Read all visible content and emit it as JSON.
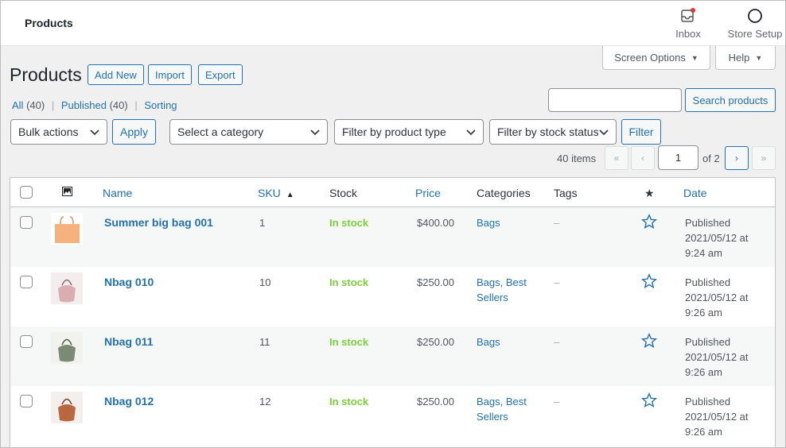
{
  "header": {
    "title": "Products",
    "inbox_label": "Inbox",
    "store_setup_label": "Store Setup"
  },
  "screen_options_label": "Screen Options",
  "help_label": "Help",
  "page": {
    "title": "Products",
    "add_new": "Add New",
    "import": "Import",
    "export": "Export"
  },
  "views": {
    "all": "All",
    "all_count": "(40)",
    "published": "Published",
    "published_count": "(40)",
    "sorting": "Sorting",
    "separator": "|"
  },
  "search": {
    "value": "",
    "button": "Search products"
  },
  "filters": {
    "bulk_actions": "Bulk actions",
    "apply": "Apply",
    "category": "Select a category",
    "product_type": "Filter by product type",
    "stock_status": "Filter by stock status",
    "filter": "Filter"
  },
  "pagination": {
    "items": "40 items",
    "first": "«",
    "prev": "‹",
    "current": "1",
    "of": "of 2",
    "next": "›",
    "last": "»"
  },
  "table": {
    "columns": {
      "name": "Name",
      "sku": "SKU",
      "sku_sort_indicator": "▲",
      "stock": "Stock",
      "price": "Price",
      "categories": "Categories",
      "tags": "Tags",
      "featured": "★",
      "date": "Date"
    },
    "rows": [
      {
        "name": "Summer big bag 001",
        "sku": "1",
        "stock": "In stock",
        "price": "$400.00",
        "categories": "Bags",
        "tags": "–",
        "date_status": "Published",
        "date": "2021/05/12 at",
        "time": "9:24 am",
        "thumb_color": "#f6b27d"
      },
      {
        "name": "Nbag 010",
        "sku": "10",
        "stock": "In stock",
        "price": "$250.00",
        "categories": "Bags, Best Sellers",
        "tags": "–",
        "date_status": "Published",
        "date": "2021/05/12 at",
        "time": "9:26 am",
        "thumb_color": "#d9aeb3"
      },
      {
        "name": "Nbag 011",
        "sku": "11",
        "stock": "In stock",
        "price": "$250.00",
        "categories": "Bags",
        "tags": "–",
        "date_status": "Published",
        "date": "2021/05/12 at",
        "time": "9:26 am",
        "thumb_color": "#7b8a72"
      },
      {
        "name": "Nbag 012",
        "sku": "12",
        "stock": "In stock",
        "price": "$250.00",
        "categories": "Bags, Best Sellers",
        "tags": "–",
        "date_status": "Published",
        "date": "2021/05/12 at",
        "time": "9:26 am",
        "thumb_color": "#b8673f"
      }
    ]
  },
  "colors": {
    "link": "#2271b1",
    "in_stock": "#7ad03a",
    "notification_dot": "#d63638"
  }
}
